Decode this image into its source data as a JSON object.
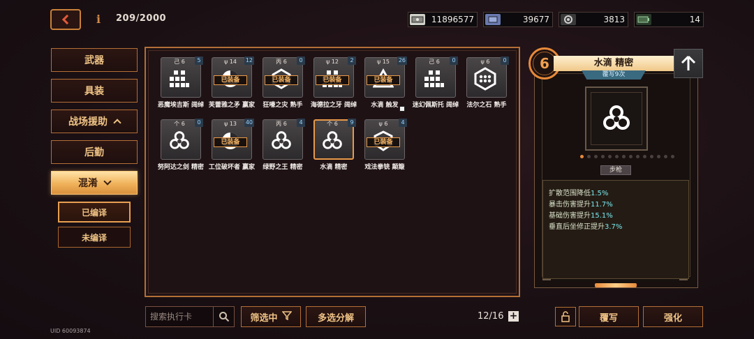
{
  "header": {
    "back_icon": "chevron-left-icon",
    "info_label": "i",
    "collection_count": "209/2000",
    "resources": [
      {
        "icon": "cash-icon",
        "value": "11896577"
      },
      {
        "icon": "chip-icon",
        "value": "39677"
      },
      {
        "icon": "gear-icon",
        "value": "3813"
      },
      {
        "icon": "battery-icon",
        "value": "14"
      }
    ]
  },
  "sidebar": {
    "items": [
      {
        "label": "武器"
      },
      {
        "label": "具装"
      },
      {
        "label": "战场援助"
      },
      {
        "label": "后勤"
      },
      {
        "label": "混淆"
      }
    ],
    "sub_items": [
      {
        "label": "已编译"
      },
      {
        "label": "未编译"
      }
    ]
  },
  "cards": [
    {
      "top": "己 6",
      "badge": "5",
      "glyph": "grid",
      "equipped": "",
      "name": "恶魔埃吉斯 阔绰"
    },
    {
      "top": "ψ 14",
      "badge": "12",
      "glyph": "swirl",
      "equipped": "已装备",
      "name": "芙蕾雅之矛 赢家"
    },
    {
      "top": "丙 6",
      "badge": "0",
      "glyph": "hex",
      "equipped": "已装备",
      "name": "狂嚎之灾 熟手"
    },
    {
      "top": "ψ 12",
      "badge": "2",
      "glyph": "grid",
      "equipped": "已装备",
      "name": "海德拉之牙 阔绰"
    },
    {
      "top": "ψ 15",
      "badge": "26",
      "glyph": "tri",
      "equipped": "已装备",
      "name": "水滴 触发"
    },
    {
      "top": "己 6",
      "badge": "0",
      "glyph": "grid",
      "equipped": "",
      "name": "迷幻佩斯托 阔绰"
    },
    {
      "top": "ψ 6",
      "badge": "0",
      "glyph": "dots",
      "equipped": "",
      "name": "法尔之石 熟手"
    },
    {
      "top": "个 6",
      "badge": "0",
      "glyph": "bio",
      "equipped": "",
      "name": "努阿达之剑 精密"
    },
    {
      "top": "ψ 13",
      "badge": "40",
      "glyph": "swirl",
      "equipped": "已装备",
      "name": "工位破坏者 赢家"
    },
    {
      "top": "丙 6",
      "badge": "4",
      "glyph": "bio",
      "equipped": "",
      "name": "绿野之王 精密"
    },
    {
      "top": "个 6",
      "badge": "9",
      "glyph": "bio",
      "equipped": "",
      "name": "水滴 精密"
    },
    {
      "top": "ψ 6",
      "badge": "4",
      "glyph": "shield",
      "equipped": "已装备",
      "name": "戏法拳铳 颠簸"
    }
  ],
  "bottom": {
    "search_placeholder": "搜索执行卡",
    "filter_label": "筛选中",
    "multi_label": "多选分解",
    "page_count": "12/16",
    "rewrite_label": "覆写",
    "enhance_label": "强化",
    "uid": "UID 60093874"
  },
  "detail": {
    "level": "6",
    "title": "水滴 精密",
    "subtitle": "覆写9次",
    "weapon_type": "步枪",
    "upgrade_icon": "arrow-up-icon",
    "progress_on": 1,
    "progress_total": 14,
    "stats": [
      {
        "label": "扩散范围降低",
        "value": "1.5%"
      },
      {
        "label": "暴击伤害提升",
        "value": "11.7%"
      },
      {
        "label": "基础伤害提升",
        "value": "15.1%"
      },
      {
        "label": "垂直后坐修正提升",
        "value": "3.7%"
      }
    ]
  },
  "colors": {
    "accent": "#e88a3a",
    "stat_value": "#7ae8f0",
    "background": "#1a1014"
  }
}
